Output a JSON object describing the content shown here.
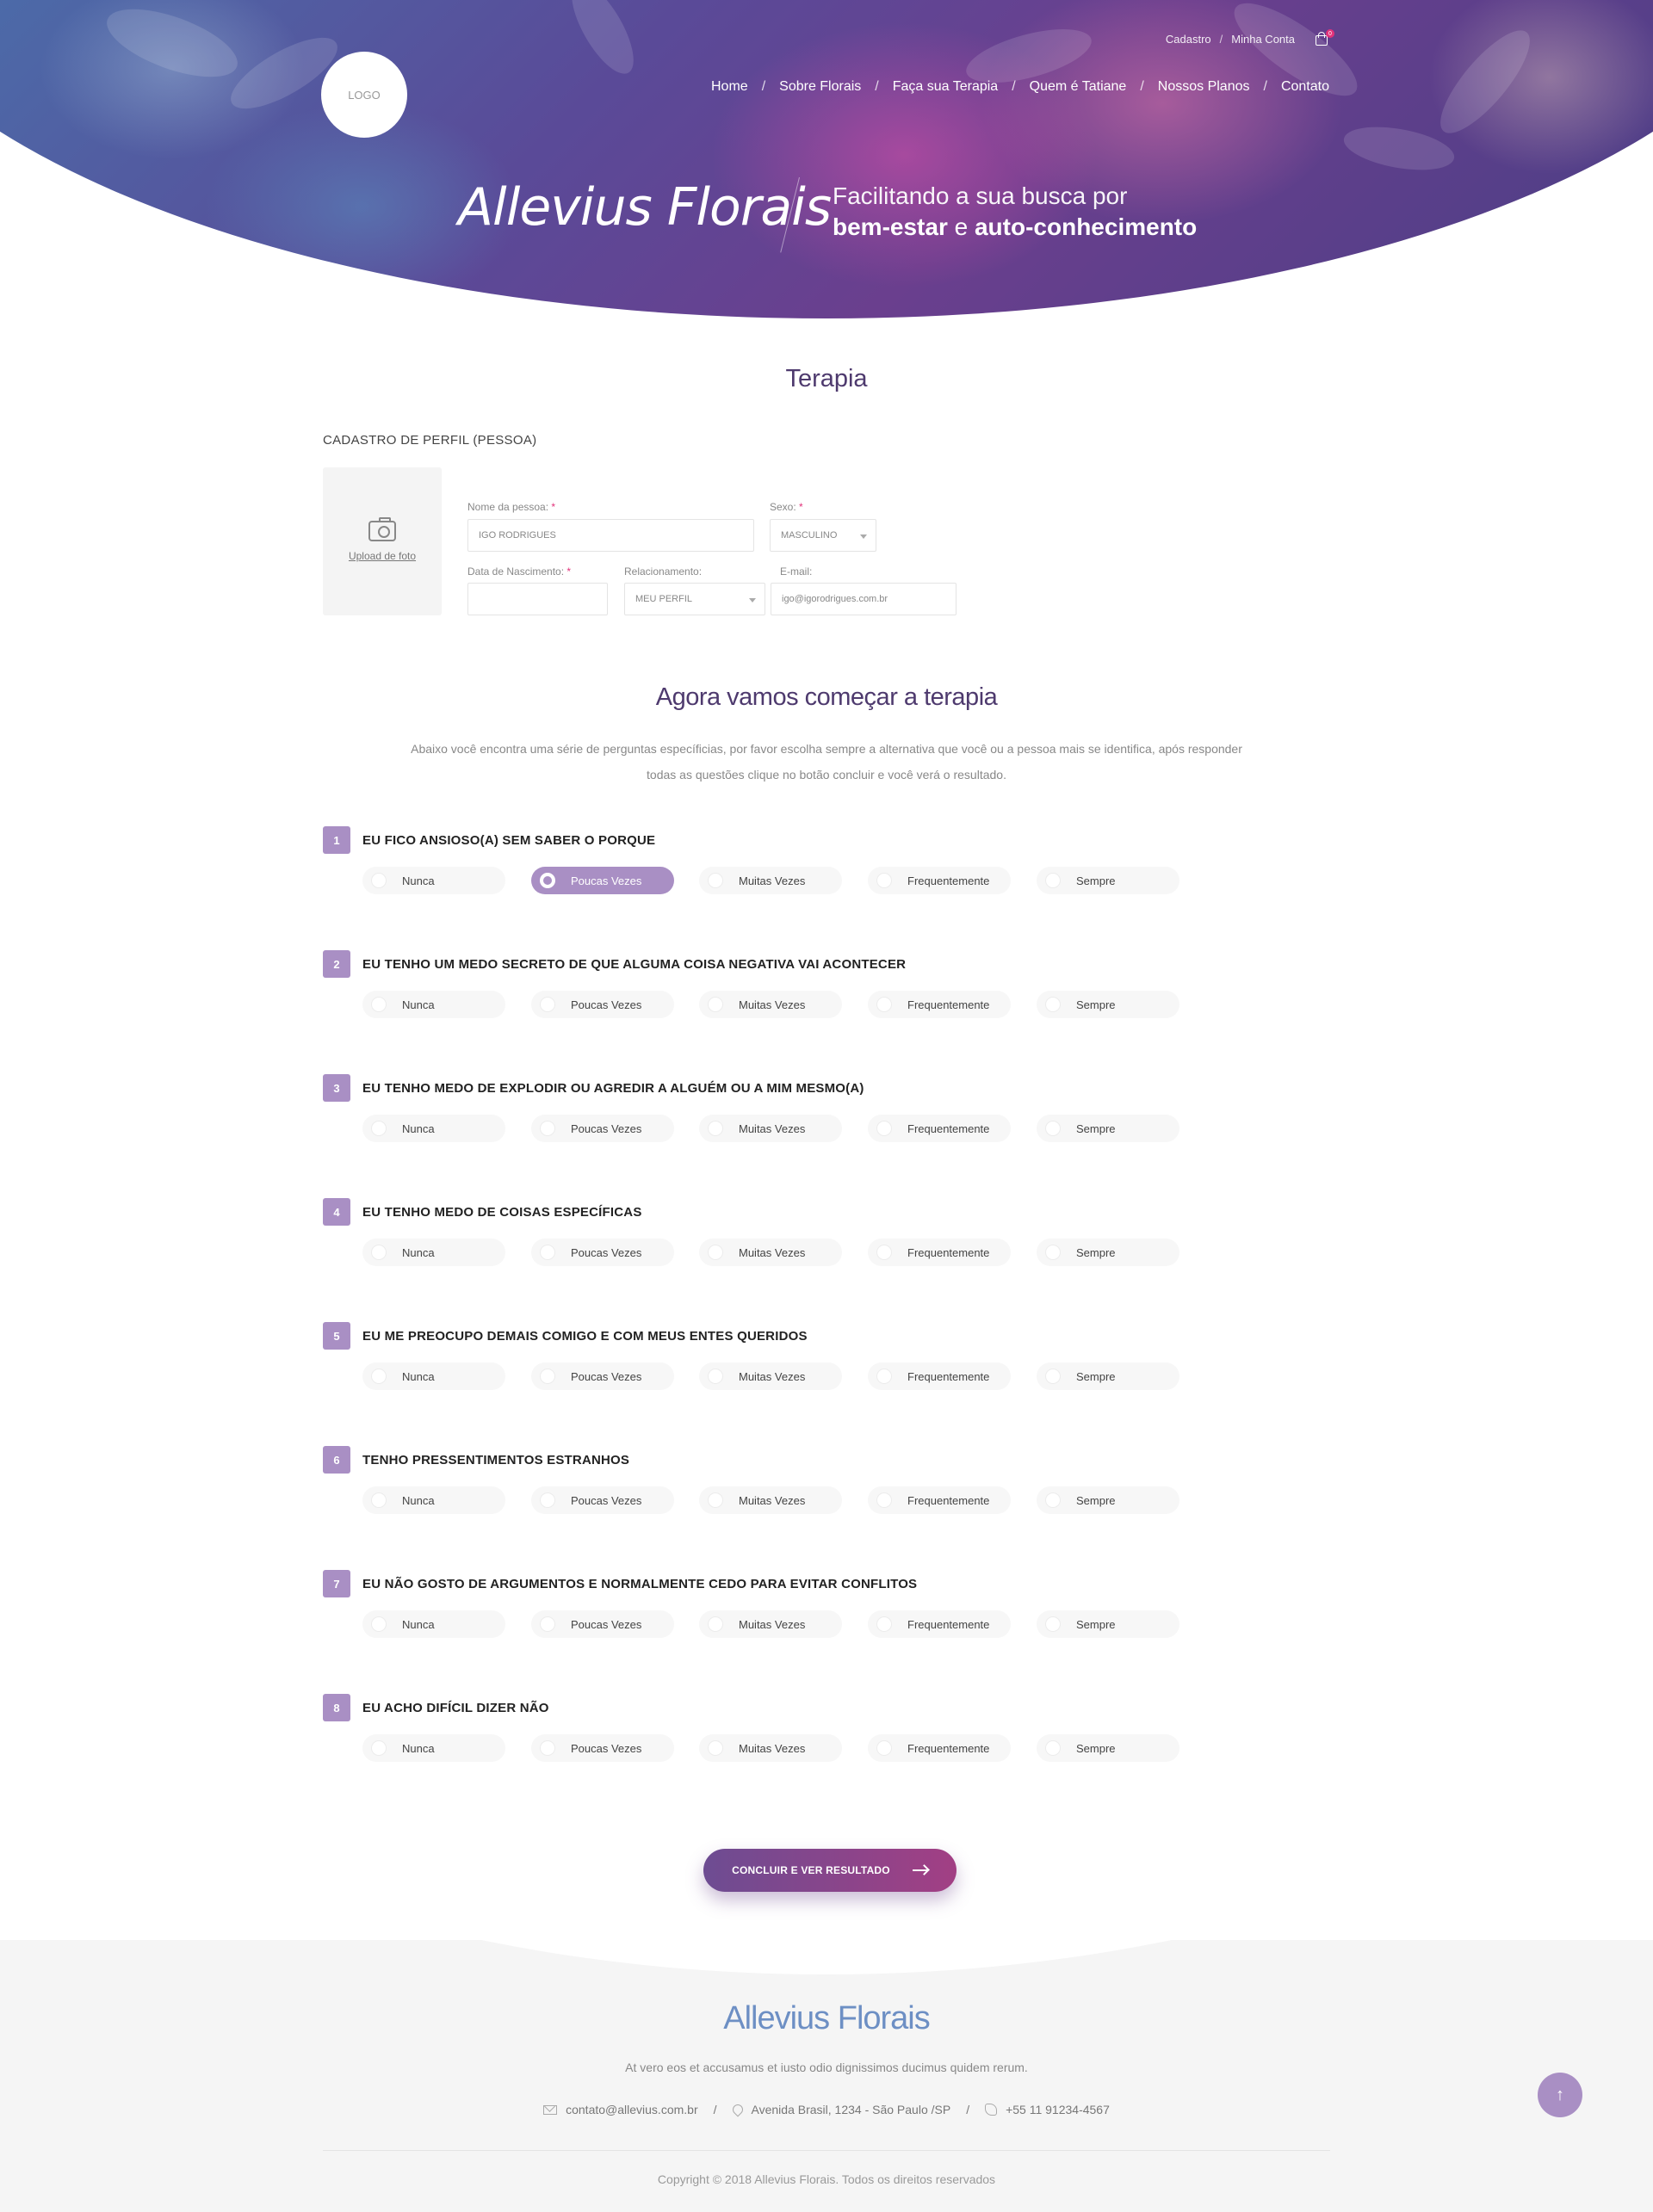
{
  "header": {
    "logo_text": "LOGO",
    "top_links": [
      "Cadastro",
      "Minha Conta"
    ],
    "cart_count": "0",
    "nav": [
      "Home",
      "Sobre Florais",
      "Faça sua Terapia",
      "Quem é Tatiane",
      "Nossos Planos",
      "Contato"
    ],
    "hero_title": "Allevius Florais",
    "hero_tag_line1": "Facilitando a sua busca por",
    "hero_tag_strong1": "bem-estar",
    "hero_tag_mid": " e ",
    "hero_tag_strong2": "auto-conhecimento"
  },
  "page_title": "Terapia",
  "profile": {
    "section_label": "CADASTRO DE PERFIL (PESSOA)",
    "upload_label": "Upload de foto",
    "name_label": "Nome da pessoa:",
    "name_value": "IGO RODRIGUES",
    "sex_label": "Sexo:",
    "sex_value": "MASCULINO",
    "birth_label": "Data de Nascimento:",
    "birth_value": "",
    "relation_label": "Relacionamento:",
    "relation_value": "MEU PERFIL",
    "email_label": "E-mail:",
    "email_value": "igo@igorodrigues.com.br",
    "required_mark": "*"
  },
  "therapy": {
    "title": "Agora vamos começar a terapia",
    "description": "Abaixo você encontra uma série de perguntas específicias, por favor escolha sempre a alternativa que você ou a pessoa mais se identifica, após responder todas as questões clique no botão concluir e você verá o resultado.",
    "options": [
      "Nunca",
      "Poucas Vezes",
      "Muitas Vezes",
      "Frequentemente",
      "Sempre"
    ],
    "questions": [
      {
        "num": "1",
        "text": "EU FICO ANSIOSO(A) SEM SABER O PORQUE",
        "selected": 1
      },
      {
        "num": "2",
        "text": "EU TENHO UM MEDO SECRETO DE QUE ALGUMA COISA NEGATIVA VAI ACONTECER",
        "selected": -1
      },
      {
        "num": "3",
        "text": "EU TENHO MEDO DE EXPLODIR OU AGREDIR A ALGUÉM OU A MIM MESMO(A)",
        "selected": -1
      },
      {
        "num": "4",
        "text": "EU TENHO MEDO DE COISAS ESPECÍFICAS",
        "selected": -1
      },
      {
        "num": "5",
        "text": "EU ME PREOCUPO DEMAIS COMIGO E COM MEUS ENTES QUERIDOS",
        "selected": -1
      },
      {
        "num": "6",
        "text": "TENHO PRESSENTIMENTOS ESTRANHOS",
        "selected": -1
      },
      {
        "num": "7",
        "text": "EU NÃO GOSTO DE ARGUMENTOS E NORMALMENTE CEDO PARA EVITAR CONFLITOS",
        "selected": -1
      },
      {
        "num": "8",
        "text": "EU ACHO DIFÍCIL DIZER NÃO",
        "selected": -1
      }
    ],
    "submit_label": "CONCLUIR E VER RESULTADO"
  },
  "footer": {
    "brand": "Allevius Florais",
    "text": "At vero eos et accusamus et iusto odio dignissimos ducimus quidem rerum.",
    "email": "contato@allevius.com.br",
    "address": "Avenida Brasil, 1234 - São Paulo /SP",
    "phone": "+55 11 91234-4567",
    "copyright": "Copyright © 2018 Allevius Florais. Todos os direitos reservados"
  },
  "colors": {
    "accent": "#a98fc4",
    "title": "#4e3a6e",
    "brand_footer": "#6d8fc4",
    "required": "#e2327a"
  },
  "icons": [
    "camera-icon",
    "cart-icon",
    "arrow-right-icon",
    "mail-icon",
    "map-pin-icon",
    "phone-icon",
    "arrow-up-icon"
  ]
}
